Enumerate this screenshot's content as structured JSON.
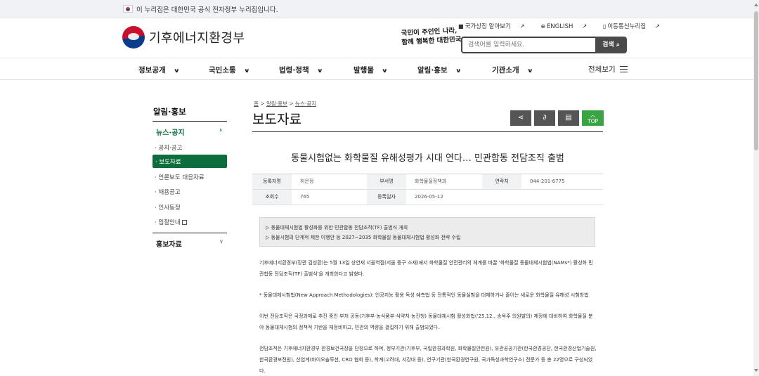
{
  "topbar": {
    "notice": "이 누리집은 대한민국 공식 전자정부 누리집입니다."
  },
  "header": {
    "logo_text": "기후에너지환경부",
    "slogan_line1": "국민이 주인인 나라,",
    "slogan_line2": "함께 행복한 대한민국",
    "utils": [
      "국가상징 알아보기",
      "ENGLISH",
      "이동통신누리집"
    ],
    "search": {
      "placeholder": "검색어를 입력하세요.",
      "button": "검색"
    }
  },
  "gnb": {
    "items": [
      "정보공개",
      "국민소통",
      "법령·정책",
      "발행물",
      "알림·홍보",
      "기관소개"
    ],
    "all_menu": "전체보기"
  },
  "lnb": {
    "title": "알림·홍보",
    "section": "뉴스·공지",
    "items": [
      "공지·공고",
      "보도자료",
      "언론보도 대응자료",
      "채용공고",
      "인사동정",
      "입찰안내"
    ],
    "active_index": 1,
    "section2": "홍보자료"
  },
  "content": {
    "breadcrumb": [
      "홈",
      "알림·홍보",
      "뉴스·공지"
    ],
    "page_title": "보도자료",
    "tools": [
      "share-icon",
      "link-icon",
      "print-icon"
    ],
    "top_label": "TOP",
    "article_title": "동물시험없는 화학물질 유해성평가 시대 연다… 민관합동 전담조직 출범",
    "meta": {
      "row1": [
        {
          "k": "등록자명",
          "v": "허은정"
        },
        {
          "k": "부서명",
          "v": "화학물질정책과"
        },
        {
          "k": "연락처",
          "v": "044-201-6775"
        }
      ],
      "row2": [
        {
          "k": "조회수",
          "v": "765"
        },
        {
          "k": "등록일자",
          "v": "2026-05-12"
        }
      ]
    },
    "summary": [
      "▷ 동물대체시험법 활성화를 위한 민관합동 전담조직(TF) 출범식 개최",
      "▷ 동물시험의 단계적 제한 이행안 등 2027~2035 화학물질 동물대체시험법 활성화 전략 수립"
    ],
    "paragraphs": [
      "기후에너지환경부(장관 김성환)는 5월 13일 상연재 서울역점(서울 중구 소재)에서 화학물질 안전관리의 체계를 바꿀 '화학물질 동물대체시험법(NAMs*) 활성화 민관합동 전담조직(TF) 출범식'을 개최한다고 밝혔다.",
      "* 동물대체시험법(New Approach Methodologies): 인공지능 활용 독성 예측법 등 전통적인 동물실험을 대체하거나 줄이는 새로운 화학물질 유해성 시험방법",
      "이번 전담조직은 국정과제로 추진 중인 부처 공동(기후부·농식품부·식약처·농진청) 동물대체시험 활성화법('25.12., 송옥주 의원발의) 제정에 대비하여 화학물질 분야 동물대체시험의 정책적 기반을 재정비하고, 민관의 역량을 결집하기 위해 출범되었다.",
      "전담조직은 기후에너지환경부 환경보건국장을 단장으로 하며, 정부기관(기후부, 국립환경과학원, 화학물질안전원), 유관공공기관(한국환경공단, 한국환경산업기술원, 한국환경보전원), 산업계(바이오솔루션, CRO 협회 등), 학계(고려대, 서강대 등), 연구기관(한국환경연구원, 국가독성과학연구소) 전문가 등 총 22명으로 구성되었다."
    ]
  }
}
